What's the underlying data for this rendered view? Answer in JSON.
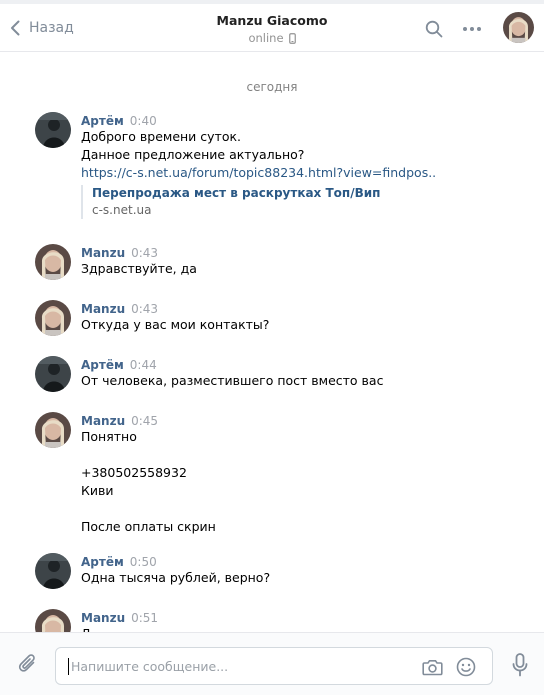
{
  "header": {
    "back_label": "Назад",
    "title": "Manzu Giacomo",
    "status": "online"
  },
  "date_separator": "сегодня",
  "messages": [
    {
      "author": "Артём",
      "time": "0:40",
      "lines": [
        "Доброго времени суток.",
        "Данное предложение актуально?"
      ],
      "link": "https://c-s.net.ua/forum/topic88234.html?view=findpos..",
      "attachment": {
        "title": "Перепродажа мест в раскрутках Топ/Вип",
        "domain": "c-s.net.ua"
      }
    },
    {
      "author": "Manzu",
      "time": "0:43",
      "lines": [
        "Здравствуйте, да"
      ]
    },
    {
      "author": "Manzu",
      "time": "0:43",
      "lines": [
        "Откуда у вас мои контакты?"
      ]
    },
    {
      "author": "Артём",
      "time": "0:44",
      "lines": [
        "От человека, разместившего пост вместо вас"
      ]
    },
    {
      "author": "Manzu",
      "time": "0:45",
      "lines": [
        "Понятно",
        "",
        "+380502558932",
        "Киви",
        "",
        "После оплаты скрин"
      ]
    },
    {
      "author": "Артём",
      "time": "0:50",
      "lines": [
        "Одна тысяча рублей, верно?"
      ]
    },
    {
      "author": "Manzu",
      "time": "0:51",
      "lines": [
        "Д"
      ]
    }
  ],
  "composer": {
    "placeholder": "Напишите сообщение..."
  },
  "colors": {
    "author": "#42648b",
    "link": "#2a5885",
    "time": "#a0a4ab",
    "icons": "#818c99"
  }
}
